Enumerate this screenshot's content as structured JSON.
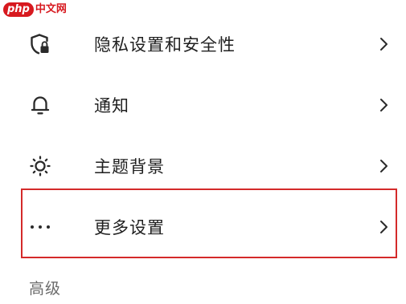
{
  "watermark": {
    "logo": "php",
    "site": "中文网"
  },
  "settings": {
    "items": [
      {
        "label": "隐私设置和安全性",
        "icon": "shield-lock-icon"
      },
      {
        "label": "通知",
        "icon": "bell-icon"
      },
      {
        "label": "主题背景",
        "icon": "sun-icon"
      },
      {
        "label": "更多设置",
        "icon": "more-dots-icon",
        "highlighted": true
      }
    ],
    "section_header": "高级"
  },
  "colors": {
    "highlight_border": "#d42a2a",
    "watermark": "#d7191f",
    "text": "#1f1f1f",
    "section_header": "#6b6b6b"
  }
}
